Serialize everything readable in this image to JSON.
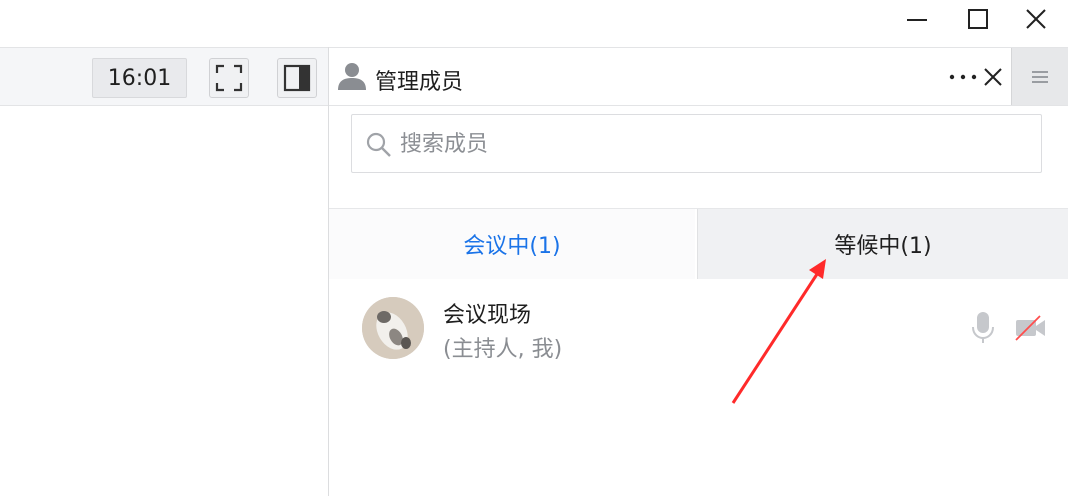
{
  "window": {
    "minimize_icon": "minimize-icon",
    "maximize_icon": "maximize-icon",
    "close_icon": "close-icon"
  },
  "toolbar": {
    "time": "16:01",
    "fullscreen_icon": "fullscreen-icon",
    "sidebar_toggle_icon": "sidebar-panel-icon"
  },
  "panel": {
    "title": "管理成员",
    "title_icon": "person-icon",
    "more_icon": "more-icon",
    "close_icon": "close-icon",
    "menu_icon": "hamburger-icon"
  },
  "search": {
    "placeholder": "搜索成员",
    "value": ""
  },
  "tabs": [
    {
      "label": "会议中(1)",
      "active": true
    },
    {
      "label": "等候中(1)",
      "active": false
    }
  ],
  "members": [
    {
      "name": "会议现场",
      "role": "(主持人, 我)",
      "mic_icon": "microphone-icon",
      "camera_icon": "camera-off-icon"
    }
  ],
  "colors": {
    "accent": "#1a73e8",
    "annotation_arrow": "#ff2a2a",
    "topbar_bg": "#f5f6f8"
  }
}
